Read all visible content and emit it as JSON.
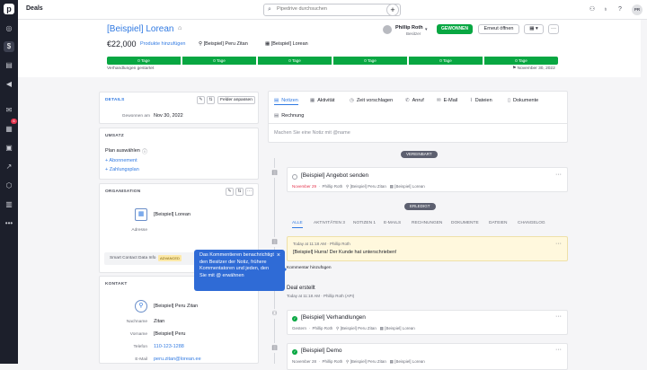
{
  "topbar": {
    "title": "Deals",
    "search_placeholder": "Pipedrive durchsuchen",
    "add": "+",
    "avatar": "PR"
  },
  "sidebar": {
    "notification_count": "6"
  },
  "deal": {
    "title": "[Beispiel] Lorean",
    "value": "€22,000",
    "add_products": "Produkte hinzufügen",
    "person": "[Beispiel] Peru Zitan",
    "organization": "[Beispiel] Lorean",
    "owner_name": "Phillip Roth",
    "owner_role": "Besitzer",
    "won_label": "GEWONNEN",
    "reopen_label": "Erneut öffnen",
    "stages": [
      "0 Tage",
      "0 Tage",
      "0 Tage",
      "0 Tage",
      "0 Tage",
      "0 Tage"
    ],
    "started_text": "Verhandlungen gestartet",
    "closed_text": "November 30, 2022"
  },
  "details": {
    "title": "DETAILS",
    "customize": "Felder anpassen",
    "won_label": "Gewonnen am",
    "won_value": "Nov 30, 2022"
  },
  "revenue": {
    "title": "UMSATZ",
    "choose_plan": "Plan auswählen",
    "subscription": "+ Abonnement",
    "payment_plan": "+ Zahlungsplan"
  },
  "organization_panel": {
    "title": "ORGANISATION",
    "name": "[Beispiel] Lorean",
    "address_label": "Adresse",
    "smart_label": "Smart Contact Data Info",
    "smart_badge": "ADVANCED"
  },
  "contact_panel": {
    "title": "KONTAKT",
    "name": "[Beispiel] Peru Zitan",
    "fields": [
      {
        "label": "Nachname",
        "value": "Zitan"
      },
      {
        "label": "Vorname",
        "value": "[Beispiel] Peru"
      },
      {
        "label": "Telefon",
        "value": "110-123-1288"
      },
      {
        "label": "E-Mail",
        "value": "peru.zitan@lorean.ee"
      }
    ]
  },
  "tabs": {
    "items": [
      "Notizen",
      "Aktivität",
      "Zeit vorschlagen",
      "Anruf",
      "E-Mail",
      "Dateien",
      "Dokumente",
      "Rechnung"
    ],
    "note_placeholder": "Machen Sie eine Notiz mit @name"
  },
  "timeline": {
    "planned_pill": "VEREINBART",
    "done_pill": "ERLEDIGT",
    "planned_activity": {
      "title": "[Beispiel] Angebot senden",
      "date": "November 29",
      "user": "Phillip Roth",
      "person": "[Beispiel] Peru Zitan",
      "org": "[Beispiel] Lorean"
    },
    "filters": {
      "all": "ALLE",
      "activities": "AKTIVITÄTEN",
      "activities_count": "3",
      "notes": "NOTIZEN",
      "notes_count": "1",
      "emails": "E-MAILS",
      "invoices": "RECHNUNGEN",
      "documents": "DOKUMENTE",
      "files": "DATEIEN",
      "changelog": "CHANGELOG"
    },
    "note": {
      "meta": "Today at 11:18 AM  ·  Phillip Roth",
      "text": "[Beispiel] Hurra! Der Kunde hat unterschrieben!",
      "comment_link": "Kommentar hinzufügen"
    },
    "created": {
      "title": "Deal erstellt",
      "meta": "Today at 11:18 AM  ·  Phillip Roth (API)"
    },
    "activity2": {
      "title": "[Beispiel] Verhandlungen",
      "date": "Gestern",
      "user": "Phillip Roth",
      "person": "[Beispiel] Peru Zitan",
      "org": "[Beispiel] Lorean"
    },
    "activity3": {
      "title": "[Beispiel] Demo",
      "date": "November 28",
      "user": "Phillip Roth",
      "person": "[Beispiel] Peru Zitan",
      "org": "[Beispiel] Lorean"
    }
  },
  "tooltip": {
    "text": "Das Kommentieren benachrichtigt den Besitzer der Notiz, frühere Kommentatoren und jeden, den Sie mit @ erwähnen",
    "close": "×"
  }
}
